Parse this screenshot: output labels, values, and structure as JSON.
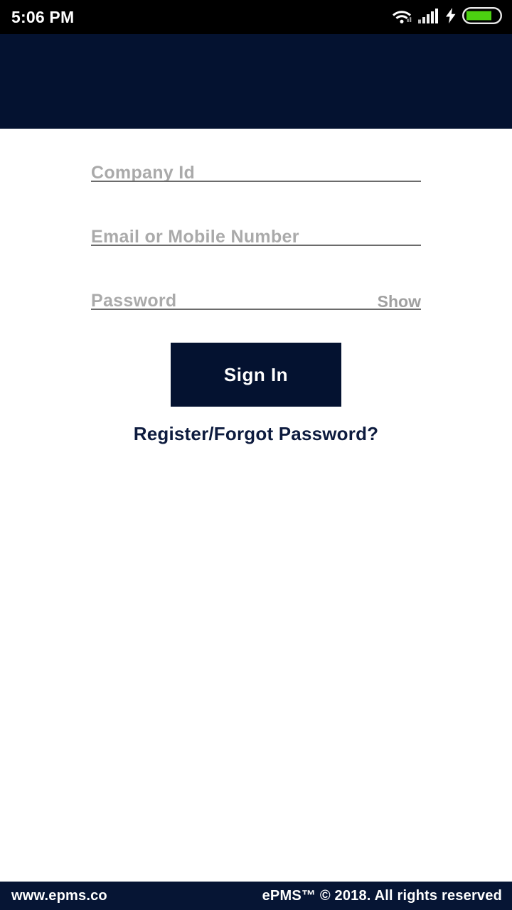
{
  "status_bar": {
    "time": "5:06 PM",
    "icons": {
      "wifi": "wifi-icon",
      "signal": "cellular-signal-icon",
      "charging": "charging-bolt-icon",
      "battery": "battery-icon"
    },
    "battery_level_percent": 70,
    "background_color": "#000000",
    "battery_fill_color": "#4CD211"
  },
  "header": {
    "background_color": "#041230"
  },
  "theme": {
    "navy": "#041230",
    "placeholder_gray": "#aaaaaa",
    "underline_gray": "#6b6b6b",
    "link_navy": "#0d1b3e"
  },
  "form": {
    "fields": [
      {
        "name": "company-id",
        "placeholder": "Company Id",
        "value": "",
        "action_label": ""
      },
      {
        "name": "email-or-mobile",
        "placeholder": "Email or Mobile Number",
        "value": "",
        "action_label": ""
      },
      {
        "name": "password",
        "placeholder": "Password",
        "value": "",
        "action_label": "Show"
      }
    ],
    "submit_label": "Sign In",
    "register_link_label": "Register/Forgot Password?"
  },
  "footer": {
    "website": "www.epms.co",
    "copyright": "ePMS™ © 2018. All rights reserved",
    "background_color": "#061534"
  }
}
